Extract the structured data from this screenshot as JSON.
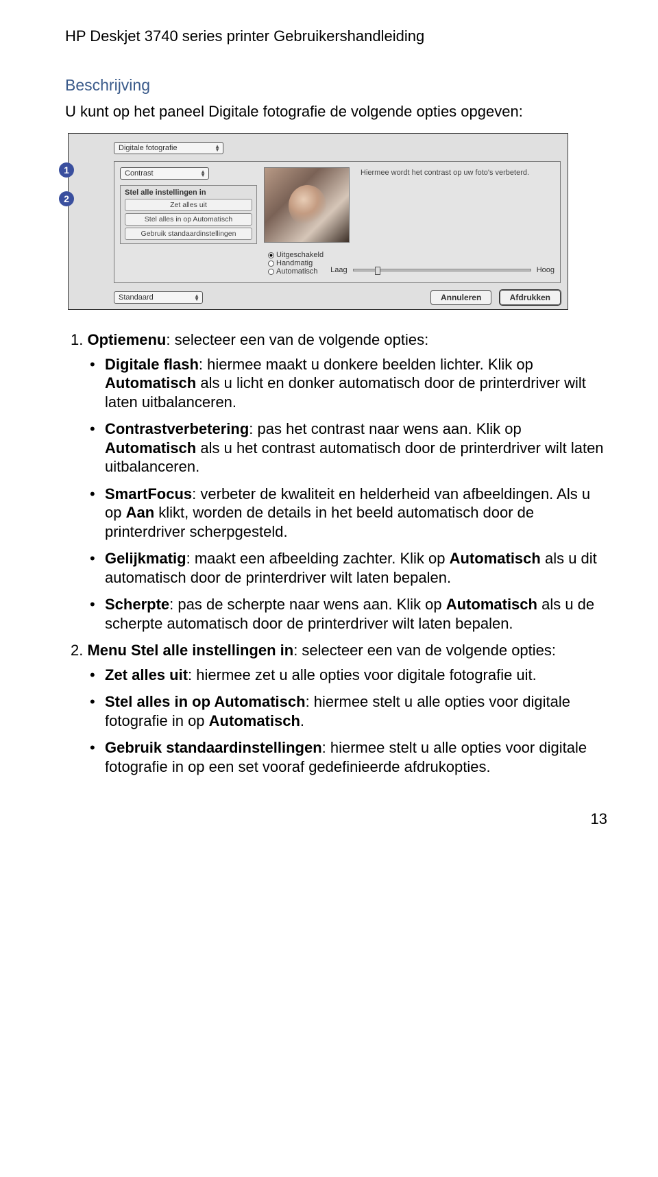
{
  "header": {
    "title": "HP Deskjet 3740 series printer Gebruikershandleiding"
  },
  "section": {
    "heading": "Beschrijving",
    "intro": "U kunt op het paneel Digitale fotografie de volgende opties opgeven:"
  },
  "dialog": {
    "topDropdown": "Digitale fotografie",
    "contrastDropdown": "Contrast",
    "helpText": "Hiermee wordt het contrast op uw foto's verbeterd.",
    "settingsBox": {
      "title": "Stel alle instellingen in",
      "options": [
        "Zet alles uit",
        "Stel alles in op Automatisch",
        "Gebruik standaardinstellingen"
      ]
    },
    "radios": {
      "off": "Uitgeschakeld",
      "manual": "Handmatig",
      "auto": "Automatisch"
    },
    "slider": {
      "low": "Laag",
      "high": "Hoog"
    },
    "presetDropdown": "Standaard",
    "cancel": "Annuleren",
    "print": "Afdrukken",
    "callouts": [
      "1",
      "2"
    ]
  },
  "list": {
    "item1_lead": "1. ",
    "item1_label": "Optiemenu",
    "item1_rest": ": selecteer een van de volgende opties:",
    "b1a_label": "Digitale flash",
    "b1a_rest": ": hiermee maakt u donkere beelden lichter. Klik op ",
    "b1a_auto": "Automatisch",
    "b1a_rest2": " als u licht en donker automatisch door de printerdriver wilt laten uitbalanceren.",
    "b1b_label": "Contrastverbetering",
    "b1b_rest": ": pas het contrast naar wens aan. Klik op ",
    "b1b_auto": "Automatisch",
    "b1b_rest2": " als u het contrast automatisch door de printerdriver wilt laten uitbalanceren.",
    "b1c_label": "SmartFocus",
    "b1c_rest": ": verbeter de kwaliteit en helderheid van afbeeldingen. Als u op ",
    "b1c_aan": "Aan",
    "b1c_rest2": " klikt, worden de details in het beeld automatisch door de printerdriver scherpgesteld.",
    "b1d_label": "Gelijkmatig",
    "b1d_rest": ": maakt een afbeelding zachter. Klik op ",
    "b1d_auto": "Automatisch",
    "b1d_rest2": " als u dit automatisch door de printerdriver wilt laten bepalen.",
    "b1e_label": "Scherpte",
    "b1e_rest": ": pas de scherpte naar wens aan. Klik op ",
    "b1e_auto": "Automatisch",
    "b1e_rest2": " als u de scherpte automatisch door de printerdriver wilt laten bepalen.",
    "item2_lead": "2. ",
    "item2_label": "Menu Stel alle instellingen in",
    "item2_rest": ": selecteer een van de volgende opties:",
    "b2a_label": "Zet alles uit",
    "b2a_rest": ": hiermee zet u alle opties voor digitale fotografie uit.",
    "b2b_label": "Stel alles in op Automatisch",
    "b2b_rest": ": hiermee stelt u alle opties voor digitale fotografie in op ",
    "b2b_auto": "Automatisch",
    "b2b_rest2": ".",
    "b2c_label": "Gebruik standaardinstellingen",
    "b2c_rest": ": hiermee stelt u alle opties voor digitale fotografie in op een set vooraf gedefinieerde afdrukopties."
  },
  "pageNumber": "13"
}
